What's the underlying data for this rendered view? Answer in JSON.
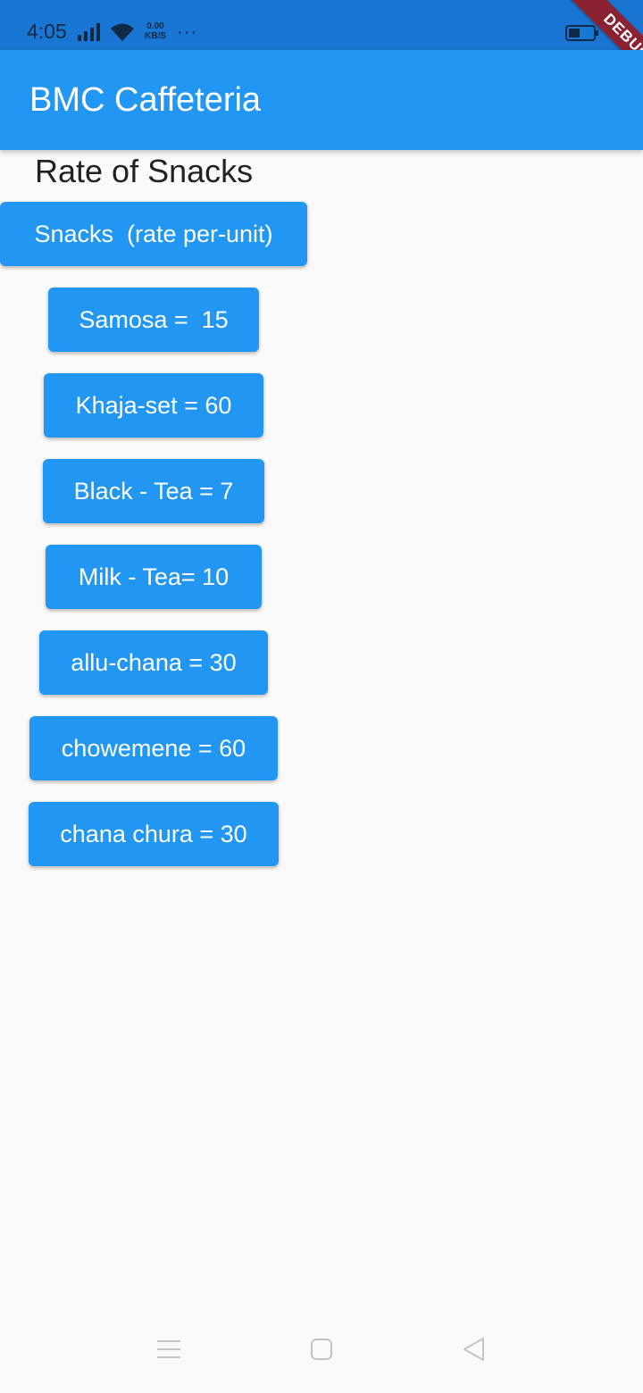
{
  "status_bar": {
    "time": "4:05",
    "net_speed_value": "0.00",
    "net_speed_unit": "KB/S",
    "more": "···",
    "icons": [
      "signal-icon",
      "wifi-icon",
      "more-icon",
      "battery-icon"
    ]
  },
  "debug_banner": "DEBUG",
  "app_bar": {
    "title": "BMC Caffeteria",
    "color": "#2196f3"
  },
  "page": {
    "heading": "Rate of Snacks"
  },
  "buttons": {
    "header": "Snacks  (rate per-unit)",
    "samosa": "Samosa =  15",
    "khaja_set": "Khaja-set = 60",
    "black_tea": "Black - Tea = 7",
    "milk_tea": "Milk - Tea= 10",
    "allu_chana": "allu-chana = 30",
    "chowemene": "chowemene = 60",
    "chana_chura": "chana chura = 30"
  },
  "nav_bar": {
    "icons": [
      "menu-icon",
      "home-icon",
      "back-icon"
    ]
  }
}
